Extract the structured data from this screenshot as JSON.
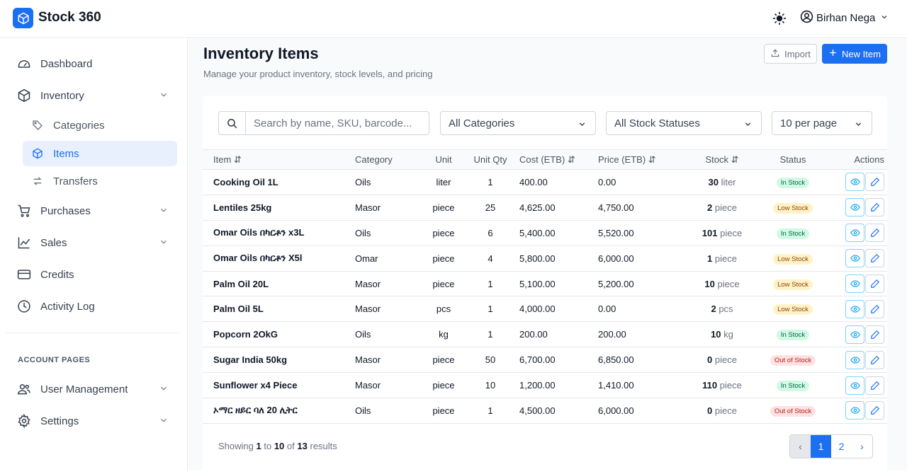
{
  "app": {
    "name": "Stock 360"
  },
  "user": {
    "name": "Birhan Nega"
  },
  "sidebar": {
    "dashboard": "Dashboard",
    "inventory": "Inventory",
    "categories": "Categories",
    "items": "Items",
    "transfers": "Transfers",
    "purchases": "Purchases",
    "sales": "Sales",
    "credits": "Credits",
    "activity_log": "Activity Log",
    "section_label": "ACCOUNT PAGES",
    "user_management": "User Management",
    "settings": "Settings",
    "active_item": "Items"
  },
  "page": {
    "title": "Inventory Items",
    "subtitle": "Manage your product inventory, stock levels, and pricing",
    "import_label": "Import",
    "new_item_label": "New Item"
  },
  "filters": {
    "search_placeholder": "Search by name, SKU, barcode...",
    "category": "All Categories",
    "stock_status": "All Stock Statuses",
    "per_page": "10 per page"
  },
  "table": {
    "headers": {
      "item": "Item",
      "category": "Category",
      "unit": "Unit",
      "unit_qty": "Unit Qty",
      "cost": "Cost (ETB)",
      "price": "Price (ETB)",
      "stock": "Stock",
      "status": "Status",
      "actions": "Actions"
    },
    "rows": [
      {
        "item": "Cooking Oil 1L",
        "category": "Oils",
        "unit": "liter",
        "unit_qty": "1",
        "cost": "400.00",
        "price": "0.00",
        "stock": "30",
        "stock_unit": "liter",
        "status": "In Stock",
        "status_type": "in"
      },
      {
        "item": "Lentiles 25kg",
        "category": "Masor",
        "unit": "piece",
        "unit_qty": "25",
        "cost": "4,625.00",
        "price": "4,750.00",
        "stock": "2",
        "stock_unit": "piece",
        "status": "Low Stock",
        "status_type": "low"
      },
      {
        "item": "Omar Oils በካርቶን x3L",
        "category": "Oils",
        "unit": "piece",
        "unit_qty": "6",
        "cost": "5,400.00",
        "price": "5,520.00",
        "stock": "101",
        "stock_unit": "piece",
        "status": "In Stock",
        "status_type": "in"
      },
      {
        "item": "Omar Oils በካርቶን X5l",
        "category": "Omar",
        "unit": "piece",
        "unit_qty": "4",
        "cost": "5,800.00",
        "price": "6,000.00",
        "stock": "1",
        "stock_unit": "piece",
        "status": "Low Stock",
        "status_type": "low"
      },
      {
        "item": "Palm Oil 20L",
        "category": "Masor",
        "unit": "piece",
        "unit_qty": "1",
        "cost": "5,100.00",
        "price": "5,200.00",
        "stock": "10",
        "stock_unit": "piece",
        "status": "Low Stock",
        "status_type": "low"
      },
      {
        "item": "Palm Oil 5L",
        "category": "Masor",
        "unit": "pcs",
        "unit_qty": "1",
        "cost": "4,000.00",
        "price": "0.00",
        "stock": "2",
        "stock_unit": "pcs",
        "status": "Low Stock",
        "status_type": "low"
      },
      {
        "item": "Popcorn 2OkG",
        "category": "Oils",
        "unit": "kg",
        "unit_qty": "1",
        "cost": "200.00",
        "price": "200.00",
        "stock": "10",
        "stock_unit": "kg",
        "status": "In Stock",
        "status_type": "in"
      },
      {
        "item": "Sugar India 50kg",
        "category": "Masor",
        "unit": "piece",
        "unit_qty": "50",
        "cost": "6,700.00",
        "price": "6,850.00",
        "stock": "0",
        "stock_unit": "piece",
        "status": "Out of Stock",
        "status_type": "out"
      },
      {
        "item": "Sunflower x4 Piece",
        "category": "Masor",
        "unit": "piece",
        "unit_qty": "10",
        "cost": "1,200.00",
        "price": "1,410.00",
        "stock": "110",
        "stock_unit": "piece",
        "status": "In Stock",
        "status_type": "in"
      },
      {
        "item": "ኦማር ዘይር ባለ 20 ሊትር",
        "category": "Oils",
        "unit": "piece",
        "unit_qty": "1",
        "cost": "4,500.00",
        "price": "6,000.00",
        "stock": "0",
        "stock_unit": "piece",
        "status": "Out of Stock",
        "status_type": "out"
      }
    ]
  },
  "pagination": {
    "showing": "Showing",
    "from": "1",
    "to_word": "to",
    "to": "10",
    "of_word": "of",
    "total": "13",
    "results_word": "results",
    "prev": "‹",
    "pages": [
      "1",
      "2"
    ],
    "next": "›",
    "current_page": "1"
  },
  "colors": {
    "accent": "#1d6ff2",
    "in_stock_bg": "#d1fae5",
    "low_stock_bg": "#fef3c7",
    "out_of_stock_bg": "#fee2e2"
  }
}
